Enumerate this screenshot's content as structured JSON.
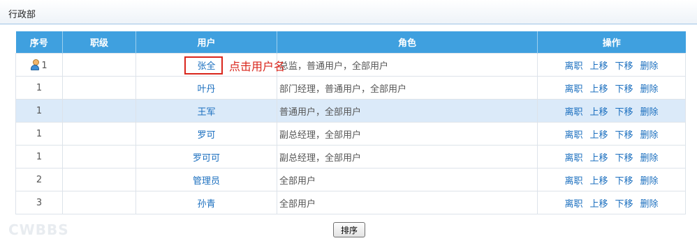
{
  "header": {
    "title": "行政部"
  },
  "table": {
    "columns": [
      "序号",
      "职级",
      "用户",
      "角色",
      "操作"
    ],
    "rows": [
      {
        "order": "1",
        "rank": "",
        "user": "张全",
        "roles": "总监，普通用户，全部用户",
        "has_icon": true
      },
      {
        "order": "1",
        "rank": "",
        "user": "叶丹",
        "roles": "部门经理，普通用户，全部用户"
      },
      {
        "order": "1",
        "rank": "",
        "user": "王军",
        "roles": "普通用户，全部用户",
        "highlight": true
      },
      {
        "order": "1",
        "rank": "",
        "user": "罗可",
        "roles": "副总经理，全部用户"
      },
      {
        "order": "1",
        "rank": "",
        "user": "罗可可",
        "roles": "副总经理，全部用户"
      },
      {
        "order": "2",
        "rank": "",
        "user": "管理员",
        "roles": "全部用户"
      },
      {
        "order": "3",
        "rank": "",
        "user": "孙青",
        "roles": "全部用户"
      }
    ],
    "actions": [
      "离职",
      "上移",
      "下移",
      "删除"
    ]
  },
  "annotation": {
    "text": "点击用户名"
  },
  "footer": {
    "sort_label": "排序"
  },
  "watermark": "CWBBS",
  "icons": {
    "user_icon": "person-icon"
  },
  "colors": {
    "header_bg": "#3fa0df",
    "link": "#1b6fbf",
    "annotation": "#d9261c",
    "highlight_row": "#dbeaf9"
  }
}
